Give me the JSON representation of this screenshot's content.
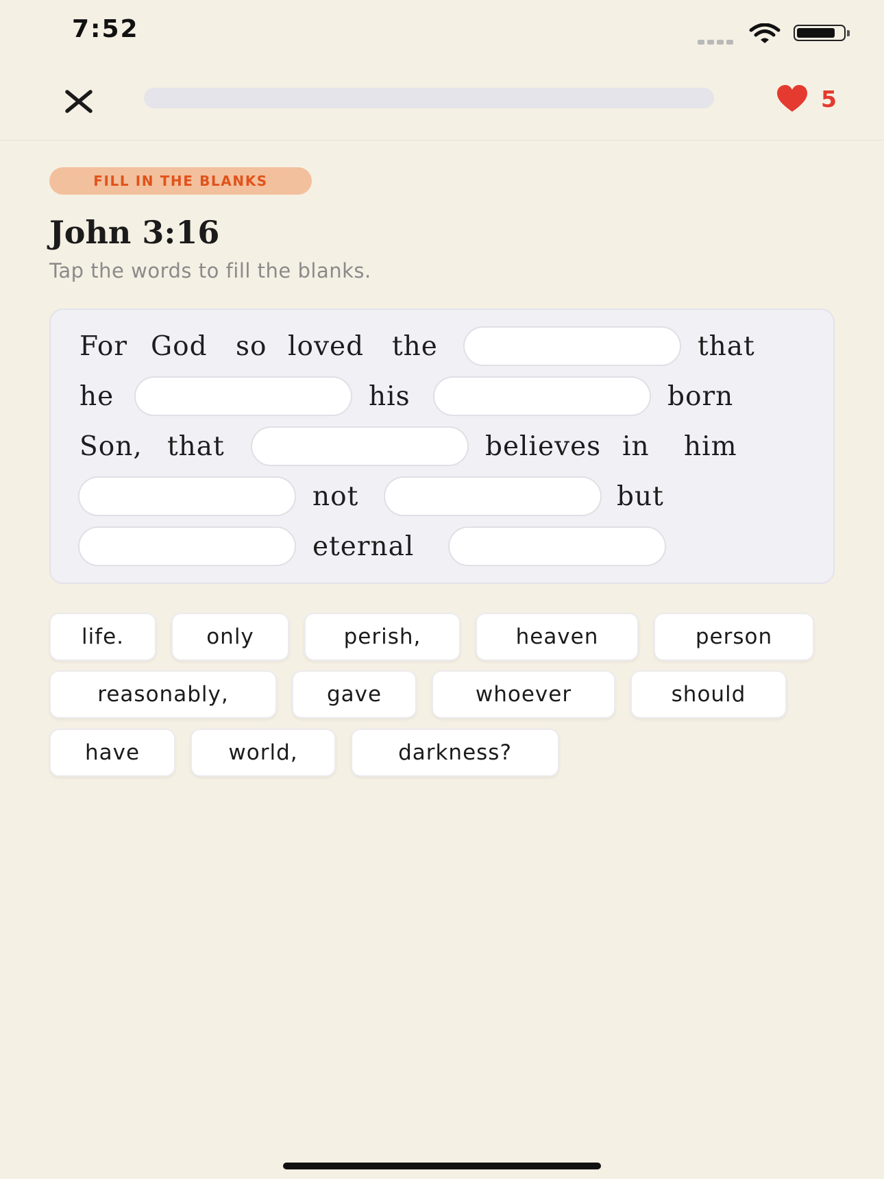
{
  "status_bar": {
    "time": "7:52"
  },
  "header": {
    "progress": 0,
    "hearts": "5"
  },
  "exercise": {
    "badge": "FILL IN THE BLANKS",
    "title": "John 3:16",
    "instruction": "Tap the words to fill the blanks."
  },
  "verse": {
    "words": [
      "For",
      "God",
      "so",
      "loved",
      "the",
      "that",
      "he",
      "his",
      "born",
      "Son,",
      "that",
      "believes",
      "in",
      "him",
      "not",
      "but",
      "eternal"
    ]
  },
  "word_bank": [
    "life.",
    "only",
    "perish,",
    "heaven",
    "person",
    "reasonably,",
    "gave",
    "whoever",
    "should",
    "have",
    "world,",
    "darkness?"
  ],
  "colors": {
    "accent": "#e85d2a",
    "heart": "#e43a2f",
    "background": "#f5f0e4",
    "badge_bg": "#f2c09d"
  }
}
